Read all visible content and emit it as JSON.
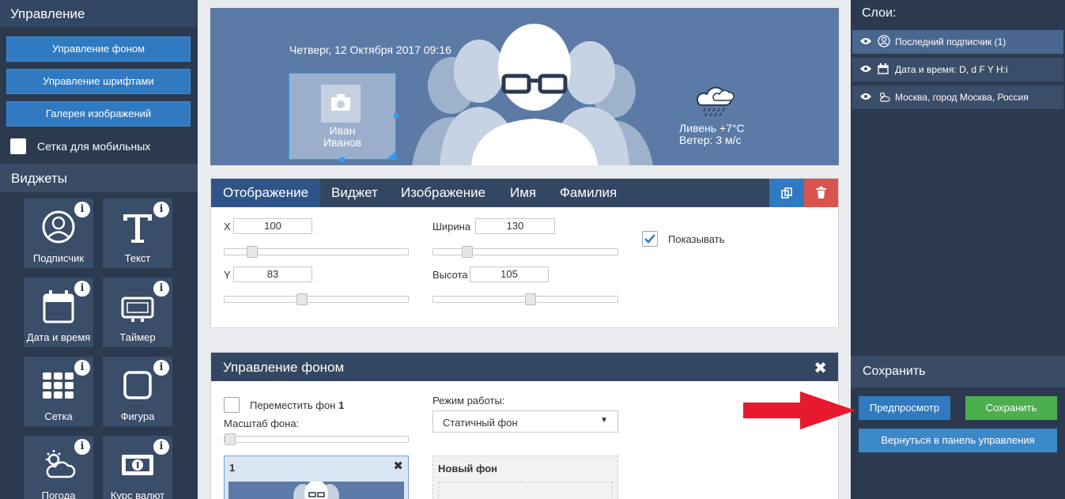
{
  "sidebar": {
    "header": "Управление",
    "buttons": [
      "Управление фоном",
      "Управление шрифтами",
      "Галерея изображений"
    ],
    "mobile_grid_label": "Сетка для мобильных",
    "widgets_header": "Виджеты",
    "widgets": [
      {
        "label": "Подписчик",
        "icon": "user-circle-icon"
      },
      {
        "label": "Текст",
        "icon": "text-icon"
      },
      {
        "label": "Дата и время",
        "icon": "calendar-icon"
      },
      {
        "label": "Таймер",
        "icon": "timer-icon"
      },
      {
        "label": "Сетка",
        "icon": "grid-icon"
      },
      {
        "label": "Фигура",
        "icon": "shape-icon"
      },
      {
        "label": "Погода",
        "icon": "weather-icon"
      },
      {
        "label": "Курс валют",
        "icon": "currency-icon"
      }
    ],
    "info_glyph": "i"
  },
  "banner": {
    "date": "Четверг, 12 Октября 2017 09:16",
    "first_name": "Иван",
    "last_name": "Иванов",
    "weather_line1": "Ливень +7°C",
    "weather_line2": "Ветер: 3 м/с"
  },
  "editor": {
    "tabs": [
      "Отображение",
      "Виджет",
      "Изображение",
      "Имя",
      "Фамилия"
    ],
    "active_tab": "Отображение",
    "x_label": "X",
    "x_value": "100",
    "y_label": "Y",
    "y_value": "83",
    "width_label": "Ширина",
    "width_value": "130",
    "height_label": "Высота",
    "height_value": "105",
    "show_label": "Показывать",
    "show_checked": true
  },
  "bg_panel": {
    "title": "Управление фоном",
    "move_label": "Переместить фон",
    "move_num": "1",
    "scale_label": "Масштаб фона:",
    "mode_label": "Режим работы:",
    "mode_value": "Статичный фон",
    "thumb_num": "1",
    "new_bg": "Новый фон"
  },
  "right": {
    "layers_header": "Слои:",
    "layers": [
      {
        "label": "Последний подписчик (1)",
        "icon": "user-circle-icon"
      },
      {
        "label": "Дата и время: D, d F Y H:i",
        "icon": "calendar-icon"
      },
      {
        "label": "Москва, город Москва, Россия",
        "icon": "weather-icon"
      }
    ],
    "save_header": "Сохранить",
    "preview_btn": "Предпросмотр",
    "save_btn": "Сохранить",
    "back_btn": "Вернуться в панель управления"
  },
  "colors": {
    "sidebar_bg": "#2c3a4f",
    "accent_blue": "#2f7ac1",
    "green": "#4cae4c",
    "red": "#d9534f",
    "banner_bg": "#5b7aa6"
  }
}
